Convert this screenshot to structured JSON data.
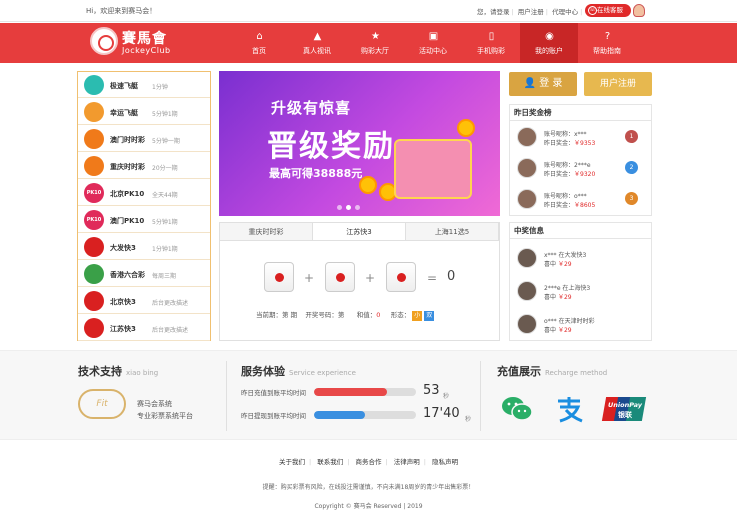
{
  "topbar": {
    "welcome": "Hi，欢迎来到赛马会！",
    "login_prefix": "您，请登录",
    "links": [
      "用户注册",
      "代理中心"
    ],
    "cs_label": "在线客服"
  },
  "logo": {
    "cn": "賽馬會",
    "en": "JockeyClub"
  },
  "nav": [
    {
      "label": "首页",
      "icon": "home-icon",
      "glyph": "⌂"
    },
    {
      "label": "真人视讯",
      "icon": "triangle-icon",
      "glyph": "▲"
    },
    {
      "label": "购彩大厅",
      "icon": "star-icon",
      "glyph": "★"
    },
    {
      "label": "活动中心",
      "icon": "gift-icon",
      "glyph": "▣"
    },
    {
      "label": "手机购彩",
      "icon": "phone-icon",
      "glyph": "▯"
    },
    {
      "label": "我的账户",
      "icon": "user-icon",
      "glyph": "◉"
    },
    {
      "label": "帮助指南",
      "icon": "help-icon",
      "glyph": "?"
    }
  ],
  "lotteries": [
    {
      "name": "极速飞艇",
      "desc": "1分钟",
      "color": "#2bbcb0",
      "badge": ""
    },
    {
      "name": "幸运飞艇",
      "desc": "5分钟1期",
      "color": "#f29a2e",
      "badge": ""
    },
    {
      "name": "澳门时时彩",
      "desc": "5分钟一期",
      "color": "#f07a1a",
      "badge": ""
    },
    {
      "name": "重庆时时彩",
      "desc": "20分一期",
      "color": "#f07a1a",
      "badge": ""
    },
    {
      "name": "北京PK10",
      "desc": "全天44期",
      "color": "#e02a5a",
      "badge": "PK10"
    },
    {
      "name": "澳门PK10",
      "desc": "5分钟1期",
      "color": "#e02a5a",
      "badge": "PK10"
    },
    {
      "name": "大发快3",
      "desc": "1分钟1期",
      "color": "#d92020",
      "badge": ""
    },
    {
      "name": "香港六合彩",
      "desc": "每周三期",
      "color": "#3aa048",
      "badge": ""
    },
    {
      "name": "北京快3",
      "desc": "后台更改描述",
      "color": "#d92020",
      "badge": ""
    },
    {
      "name": "江苏快3",
      "desc": "后台更改描述",
      "color": "#d92020",
      "badge": ""
    }
  ],
  "banner": {
    "line1": "升级有惊喜",
    "line2": "晋级奖励",
    "line3": "最高可得38888元"
  },
  "draw": {
    "tabs": [
      "重庆时时彩",
      "江苏快3",
      "上海11选5"
    ],
    "active_tab": 1,
    "ops": [
      "+",
      "+",
      "="
    ],
    "sum": "0",
    "current_label": "当前期：第 期",
    "open_label": "开奖号码：第",
    "sum_label": "和值：",
    "sum_value": "0",
    "shape_label": "形态：",
    "tag_small": "小",
    "tag_double": "双",
    "tag_small_color": "#f0a020",
    "tag_double_color": "#3a8fe0"
  },
  "auth": {
    "login": "登 录",
    "register": "用户注册"
  },
  "rank": {
    "title": "昨日奖金榜",
    "rows": [
      {
        "name": "账号昵称：x***",
        "prize_label": "昨日奖金：",
        "prize": "￥9353",
        "num": "1",
        "color": "#c0504d"
      },
      {
        "name": "账号昵称：2***e",
        "prize_label": "昨日奖金：",
        "prize": "￥9320",
        "num": "2",
        "color": "#3a8fe0"
      },
      {
        "name": "账号昵称：o***",
        "prize_label": "昨日奖金：",
        "prize": "￥8605",
        "num": "3",
        "color": "#e0882a"
      }
    ]
  },
  "winners": {
    "title": "中奖信息",
    "rows": [
      {
        "line1": "x*** 在大发快3",
        "prize_label": "喜中",
        "prize": "￥29"
      },
      {
        "line1": "2***e 在上海快3",
        "prize_label": "喜中",
        "prize": "￥29"
      },
      {
        "line1": "o*** 在天津时时彩",
        "prize_label": "喜中",
        "prize": "￥29"
      }
    ]
  },
  "features": {
    "tech": {
      "title": "技术支持",
      "sub": "xiao bing",
      "line1": "赛马会系统",
      "line2": "专业彩票系统平台",
      "logo_text": "Fit"
    },
    "service": {
      "title": "服务体验",
      "sub": "Service experience",
      "rows": [
        {
          "label": "昨日充值到账平均时间",
          "value": "53",
          "unit": "秒",
          "fill": 0.72,
          "color": "#e84848"
        },
        {
          "label": "昨日提现到账平均时间",
          "value": "17'40",
          "unit": "秒",
          "fill": 0.5,
          "color": "#3a8fe0"
        }
      ]
    },
    "recharge": {
      "title": "充值展示",
      "sub": "Recharge method",
      "unionpay_en": "UnionPay",
      "unionpay_cn": "银联"
    }
  },
  "footer": {
    "links": [
      "关于我们",
      "联系我们",
      "商务合作",
      "法律声明",
      "隐私声明"
    ],
    "tip": "提醒：购买彩票有风险，在线投注需谨慎，不向未满18周岁的青少年出售彩票！",
    "copyright": "Copyright © 赛马会 Reserved | 2019"
  }
}
